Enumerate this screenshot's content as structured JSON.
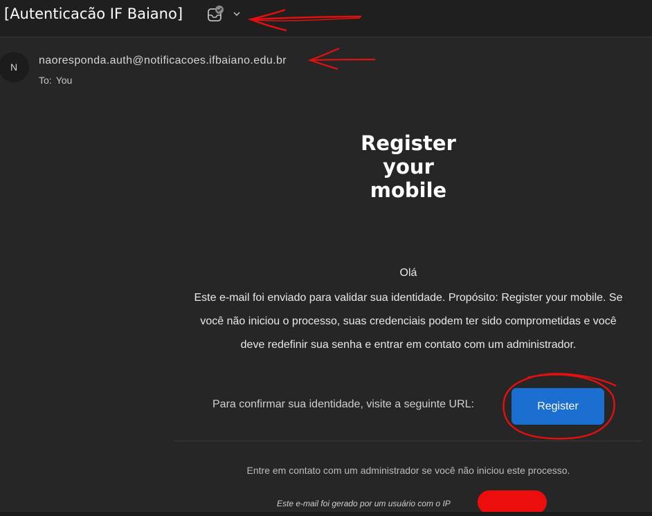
{
  "header": {
    "subject": "[Autenticacão IF Baiano]",
    "action_icon": "mail-check-icon",
    "dropdown_icon": "chevron-down-icon"
  },
  "sender": {
    "avatar_initial": "N",
    "email": "naoresponda.auth@notificacoes.ifbaiano.edu.br",
    "to_label": "To:",
    "to_value": "You"
  },
  "message": {
    "title_lines": [
      "Register",
      "your",
      "mobile"
    ],
    "greeting": "Olá",
    "body": "Este e-mail foi enviado para validar sua identidade. Propósito: Register your mobile. Se você não iniciou o processo, suas credenciais podem ter sido comprometidas e você deve redefinir sua senha e entrar em contato com um administrador.",
    "confirm_text": "Para confirmar sua identidade, visite a seguinte URL:",
    "register_label": "Register",
    "footer": "Entre em contato com um administrador se você não iniciou este processo.",
    "ip_text": "Este e-mail foi gerado por um usuário com o IP"
  },
  "colors": {
    "background": "#262626",
    "header_bg": "#1f1f1f",
    "button_blue": "#1a6fd1",
    "annotation_red": "#e41010"
  }
}
